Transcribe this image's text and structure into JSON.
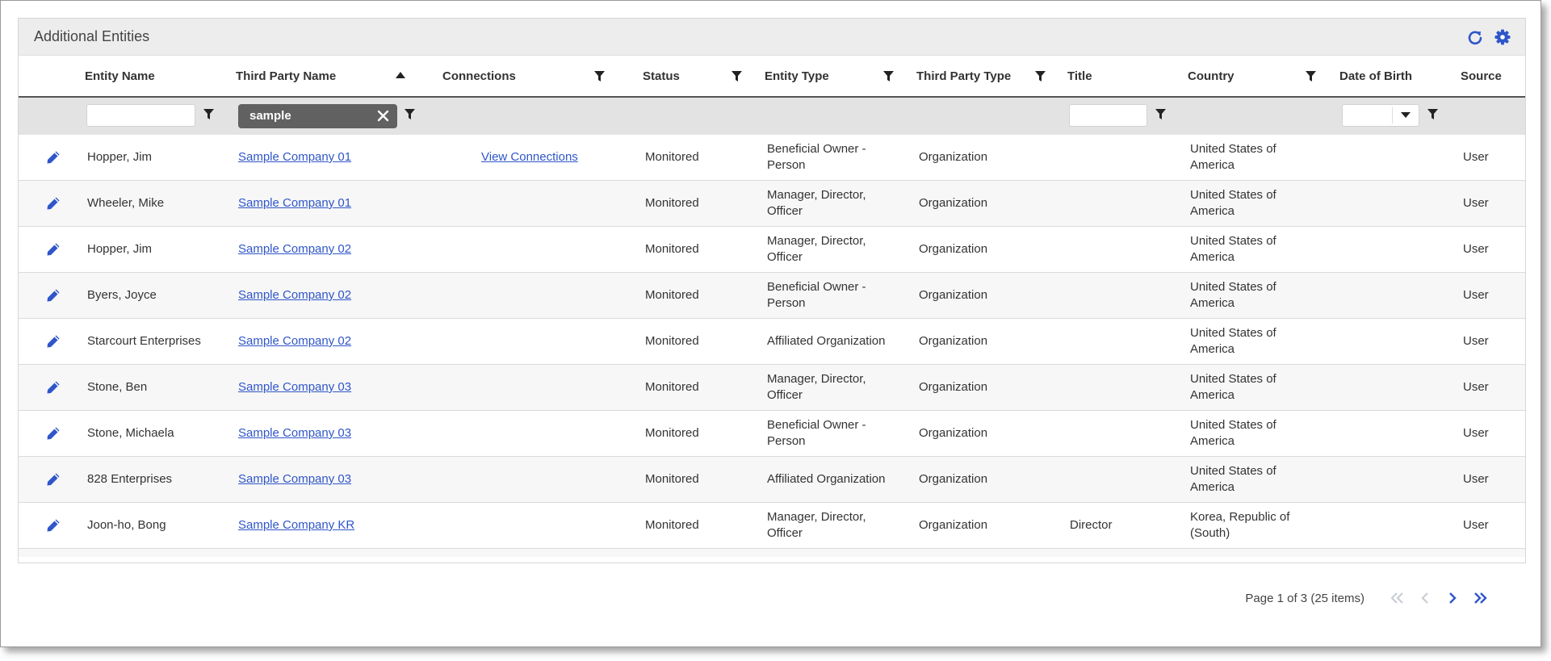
{
  "panel": {
    "title": "Additional Entities"
  },
  "toolbar": {
    "refresh_icon": "refresh-icon",
    "settings_icon": "gear-icon"
  },
  "colors": {
    "accent": "#2f56c9",
    "chip": "#616161",
    "filter_row": "#e3e3e3"
  },
  "columns": [
    {
      "key": "entity_name",
      "label": "Entity Name"
    },
    {
      "key": "third_party_name",
      "label": "Third Party Name",
      "sort": "ascending"
    },
    {
      "key": "connections",
      "label": "Connections",
      "filter": true
    },
    {
      "key": "status",
      "label": "Status",
      "filter": true
    },
    {
      "key": "entity_type",
      "label": "Entity Type",
      "filter": true
    },
    {
      "key": "third_party_type",
      "label": "Third Party Type",
      "filter": true
    },
    {
      "key": "title",
      "label": "Title"
    },
    {
      "key": "country",
      "label": "Country",
      "filter": true
    },
    {
      "key": "dob",
      "label": "Date of Birth"
    },
    {
      "key": "source",
      "label": "Source"
    }
  ],
  "filters": {
    "entity_name_value": "",
    "third_party_name_value": "sample",
    "title_value": "",
    "dob_value": ""
  },
  "rows": [
    {
      "entity_name": "Hopper, Jim",
      "third_party_name": "Sample Company 01",
      "connections": "View Connections",
      "status": "Monitored",
      "entity_type": "Beneficial Owner - Person",
      "third_party_type": "Organization",
      "title": "",
      "country": "United States of America",
      "dob": "",
      "source": "User"
    },
    {
      "entity_name": "Wheeler, Mike",
      "third_party_name": "Sample Company 01",
      "connections": "",
      "status": "Monitored",
      "entity_type": "Manager, Director, Officer",
      "third_party_type": "Organization",
      "title": "",
      "country": "United States of America",
      "dob": "",
      "source": "User"
    },
    {
      "entity_name": "Hopper, Jim",
      "third_party_name": "Sample Company 02",
      "connections": "",
      "status": "Monitored",
      "entity_type": "Manager, Director, Officer",
      "third_party_type": "Organization",
      "title": "",
      "country": "United States of America",
      "dob": "",
      "source": "User"
    },
    {
      "entity_name": "Byers, Joyce",
      "third_party_name": "Sample Company 02",
      "connections": "",
      "status": "Monitored",
      "entity_type": "Beneficial Owner - Person",
      "third_party_type": "Organization",
      "title": "",
      "country": "United States of America",
      "dob": "",
      "source": "User"
    },
    {
      "entity_name": "Starcourt Enterprises",
      "third_party_name": "Sample Company 02",
      "connections": "",
      "status": "Monitored",
      "entity_type": "Affiliated Organization",
      "third_party_type": "Organization",
      "title": "",
      "country": "United States of America",
      "dob": "",
      "source": "User"
    },
    {
      "entity_name": "Stone, Ben",
      "third_party_name": "Sample Company 03",
      "connections": "",
      "status": "Monitored",
      "entity_type": "Manager, Director, Officer",
      "third_party_type": "Organization",
      "title": "",
      "country": "United States of America",
      "dob": "",
      "source": "User"
    },
    {
      "entity_name": "Stone, Michaela",
      "third_party_name": "Sample Company 03",
      "connections": "",
      "status": "Monitored",
      "entity_type": "Beneficial Owner - Person",
      "third_party_type": "Organization",
      "title": "",
      "country": "United States of America",
      "dob": "",
      "source": "User"
    },
    {
      "entity_name": "828 Enterprises",
      "third_party_name": "Sample Company 03",
      "connections": "",
      "status": "Monitored",
      "entity_type": "Affiliated Organization",
      "third_party_type": "Organization",
      "title": "",
      "country": "United States of America",
      "dob": "",
      "source": "User"
    },
    {
      "entity_name": "Joon-ho, Bong",
      "third_party_name": "Sample Company KR",
      "connections": "",
      "status": "Monitored",
      "entity_type": "Manager, Director, Officer",
      "third_party_type": "Organization",
      "title": "Director",
      "country": "Korea, Republic of (South)",
      "dob": "",
      "source": "User"
    }
  ],
  "pager": {
    "info": "Page 1 of 3 (25 items)"
  }
}
